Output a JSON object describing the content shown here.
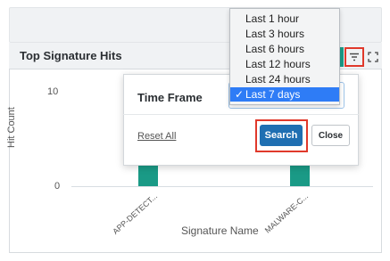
{
  "panel": {
    "title": "Top Signature Hits"
  },
  "chart_data": {
    "type": "bar",
    "categories": [
      "APP-DETECT...",
      "MALWARE-C..."
    ],
    "values": [
      15,
      15
    ],
    "xlabel": "Signature Name",
    "ylabel": "Hit Count",
    "yticks": [
      "10",
      "0"
    ],
    "colors": {
      "bar": "#1a9a86"
    }
  },
  "popup": {
    "time_frame_label": "Time Frame",
    "reset_label": "Reset All",
    "search_label": "Search",
    "close_label": "Close"
  },
  "dropdown": {
    "options": [
      "Last 1 hour",
      "Last 3 hours",
      "Last 6 hours",
      "Last 12 hours",
      "Last 24 hours",
      "Last 7 days"
    ],
    "selected": "Last 7 days",
    "check_glyph": "✓"
  },
  "icons": {
    "filter": "filter-icon",
    "expand": "expand-icon"
  },
  "colors": {
    "accent": "#1f6fb2",
    "highlight": "#e0392b",
    "selection": "#2e7cf6"
  }
}
